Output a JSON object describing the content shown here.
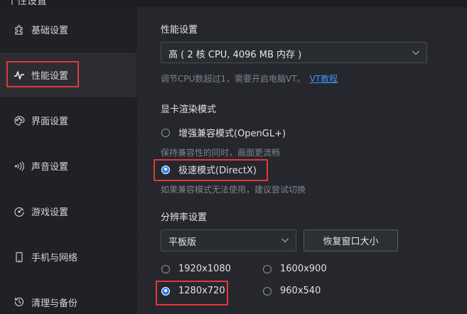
{
  "window": {
    "title": "个性设置"
  },
  "sidebar": {
    "items": [
      {
        "label": "基础设置",
        "icon": "puzzle-icon",
        "active": false
      },
      {
        "label": "性能设置",
        "icon": "pulse-icon",
        "active": true
      },
      {
        "label": "界面设置",
        "icon": "palette-icon",
        "active": false
      },
      {
        "label": "声音设置",
        "icon": "sound-icon",
        "active": false
      },
      {
        "label": "游戏设置",
        "icon": "gamepad-icon",
        "active": false
      },
      {
        "label": "手机与网络",
        "icon": "phone-icon",
        "active": false
      },
      {
        "label": "清理与备份",
        "icon": "backup-icon",
        "active": false
      }
    ]
  },
  "performance": {
    "title": "性能设置",
    "selected": "高 ( 2 核 CPU, 4096 MB 内存 )",
    "hint": "调节CPU数超过1，需要开启电脑VT。",
    "hint_link": "VT教程"
  },
  "render": {
    "title": "显卡渲染模式",
    "options": [
      {
        "label": "增强兼容模式(OpenGL+)",
        "checked": false,
        "hint": "保持兼容性的同时，画面更流畅"
      },
      {
        "label": "极速模式(DirectX)",
        "checked": true,
        "hint": "如果兼容模式无法使用，建议尝试切换"
      }
    ]
  },
  "resolution": {
    "title": "分辨率设置",
    "device": "平板版",
    "restore_button": "恢复窗口大小",
    "options": [
      {
        "label": "1920x1080",
        "checked": false
      },
      {
        "label": "1600x900",
        "checked": false
      },
      {
        "label": "1280x720",
        "checked": true
      },
      {
        "label": "960x540",
        "checked": false
      }
    ]
  },
  "colors": {
    "accent": "#2f7ff3",
    "link": "#3d93f5",
    "highlight_box": "#e03a3a",
    "sidebar_bg": "#1f2126",
    "content_bg": "#25272d"
  }
}
